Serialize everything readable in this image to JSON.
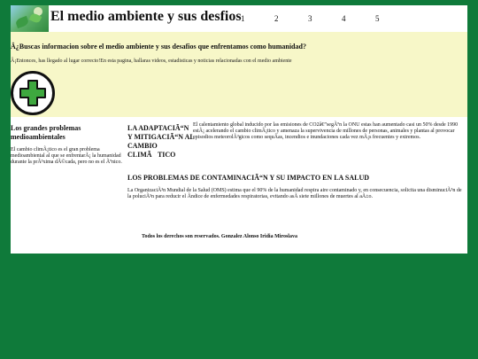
{
  "colors": {
    "page_background": "#0f7a3a",
    "header_background": "#ffffff",
    "intro_background": "#f7f7c8",
    "content_background": "#ffffff",
    "add_icon_green": "#3ea83f"
  },
  "header": {
    "logo_icon": "nature-leaves-image",
    "title": "El medio ambiente y sus desfios",
    "nav": [
      "1",
      "2",
      "3",
      "4",
      "5"
    ]
  },
  "intro": {
    "heading": "Â¿Buscas informacion sobre el medio ambiente y sus desafios que enfrentamos como humanidad?",
    "text": "Â¡Entonces, has llegado al lugar correcto!En esta pagina, hallaras videos, estadisticas y noticias relacionadas con el medio ambiente",
    "button_icon": "plus-icon"
  },
  "sidebar": {
    "title": "Los grandes problemas medioambientales",
    "text": "El cambio climÃ¡tico es el gran problema medioambiental al que se enfrentarÃ¡ la humanidad durante la prÃ³xima dÃ©cada, pero no es el Ãºnico."
  },
  "section1": {
    "title": "LA ADAPTACIÃ“N Y MITIGACIÃ“N AL CAMBIO CLIMÃTICO",
    "text": "El calentamiento global inducido por las emisiones de CO2â€”segÃºn la ONU estas han aumentado casi un 50% desde 1990 estÃ¡ acelerando el cambio climÃ¡tico y amenaza la supervivencia de millones de personas, animales y plantas al provocar episodios meteorolÃ³gicos como sequÃ­as, incendios e inundaciones cada vez mÃ¡s frecuentes y extremos."
  },
  "section2": {
    "title": "LOS PROBLEMAS DE CONTAMINACIÃ“N Y SU IMPACTO EN LA SALUD",
    "text": "La OrganizaciÃ³n Mundial de la Salud (OMS) estima que el 90% de la humanidad respira aire contaminado y, en consecuencia, solicita una disminuciÃ³n de la poluciÃ³n para reducir el Ã­ndice de enfermedades respiratorias, evitando asÃ­ siete millones de muertes al aÃ±o."
  },
  "footer": {
    "text": "Todos los derechos son reservados. Gonzalez Alonso Iridia Miroslava"
  }
}
